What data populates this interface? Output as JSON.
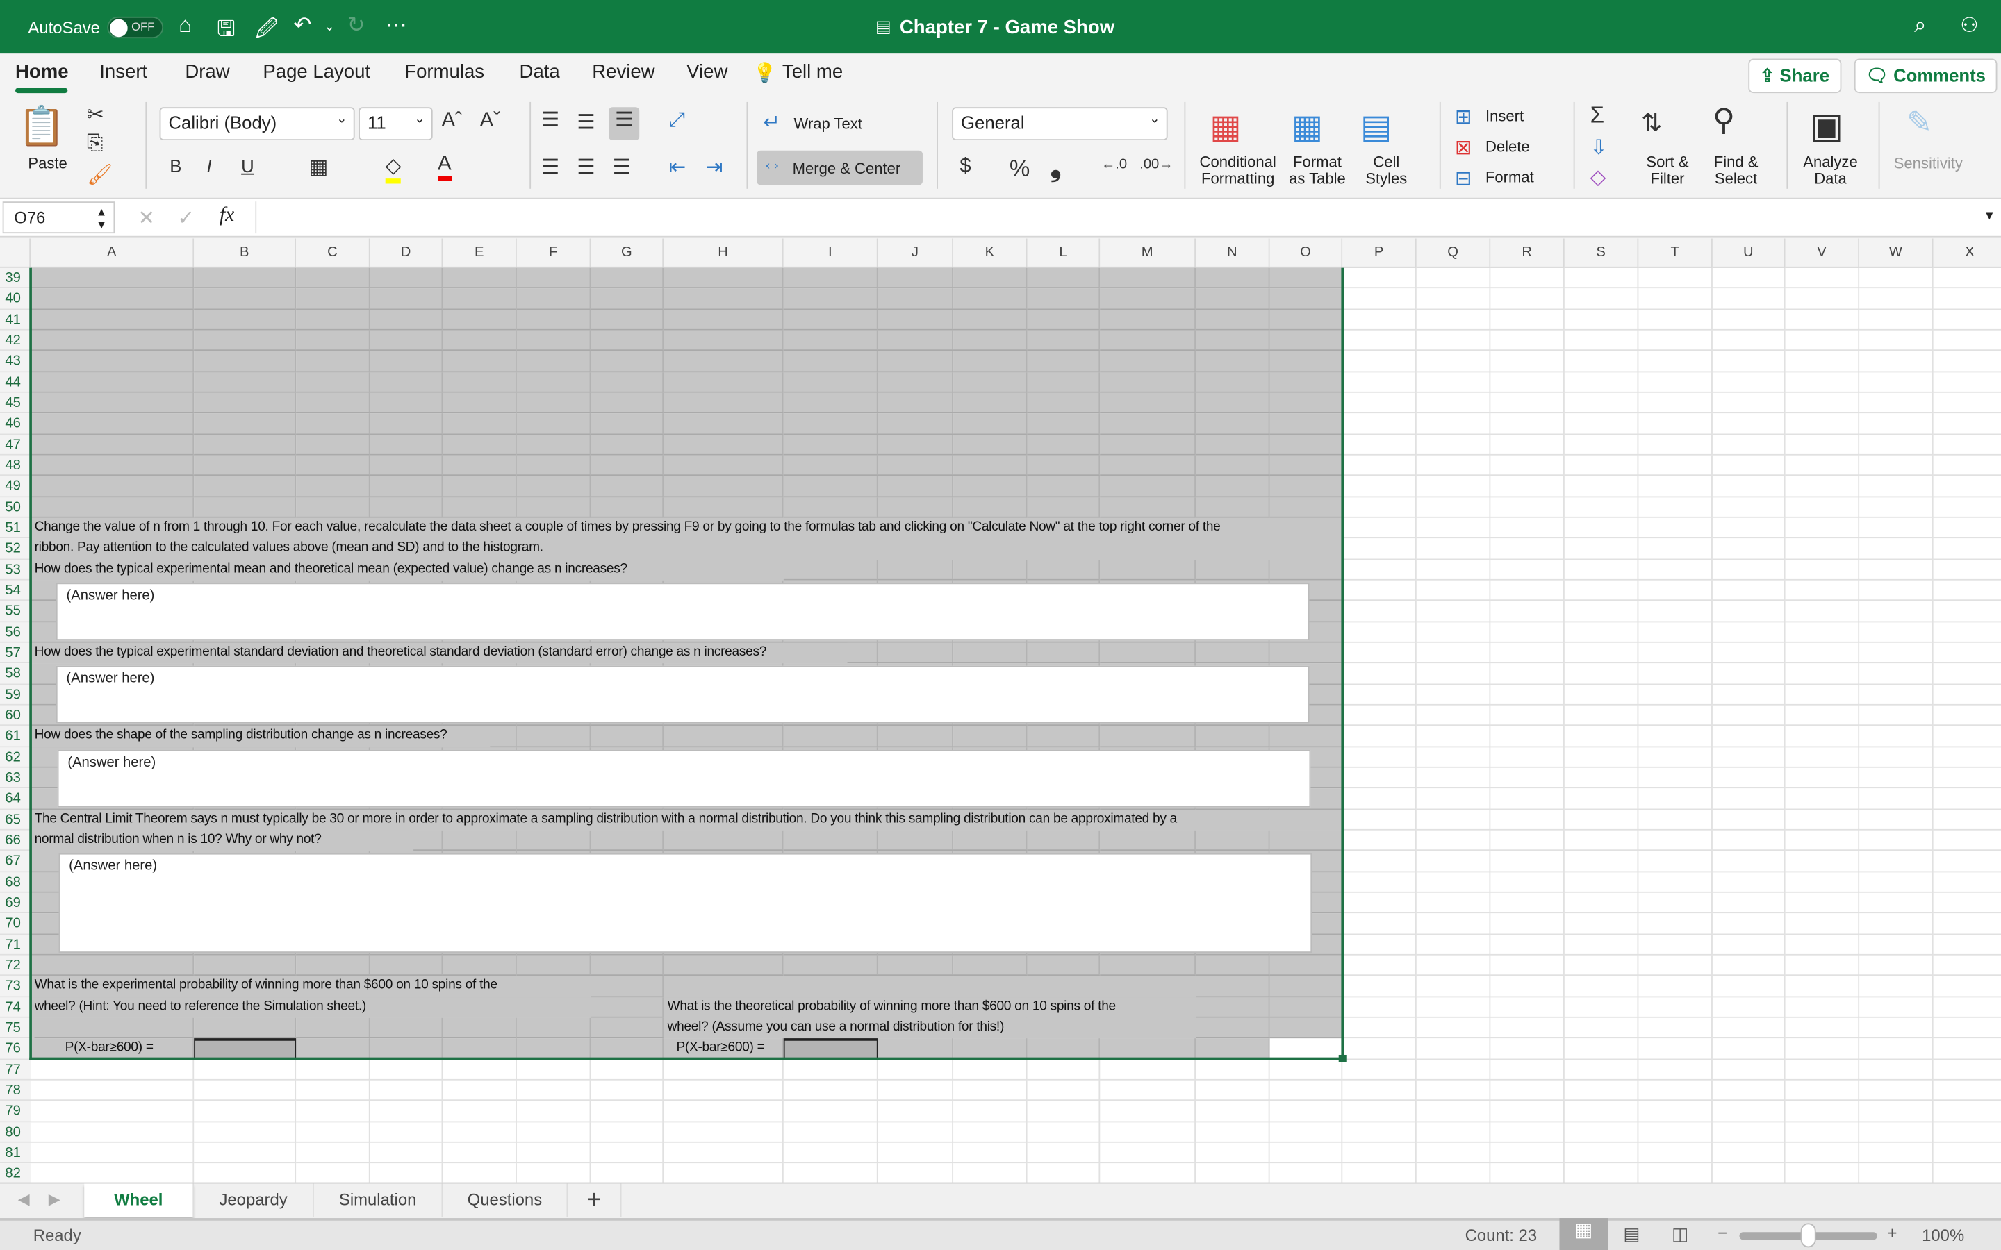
{
  "titlebar": {
    "autosave": "AutoSave",
    "autosave_state": "OFF",
    "title": "Chapter 7 - Game Show"
  },
  "tabs": [
    "Home",
    "Insert",
    "Draw",
    "Page Layout",
    "Formulas",
    "Data",
    "Review",
    "View",
    "Tell me"
  ],
  "actions": {
    "share": "Share",
    "comments": "Comments"
  },
  "ribbon": {
    "paste": "Paste",
    "font": "Calibri (Body)",
    "size": "11",
    "bold": "B",
    "italic": "I",
    "underline": "U",
    "wrap_text": "Wrap Text",
    "merge_center": "Merge & Center",
    "number_format": "General",
    "currency": "$",
    "percent": "%",
    "comma": "❟",
    "conditional_formatting": [
      "Conditional",
      "Formatting"
    ],
    "format_as_table": [
      "Format",
      "as Table"
    ],
    "cell_styles": [
      "Cell",
      "Styles"
    ],
    "insert": "Insert",
    "delete": "Delete",
    "format": "Format",
    "sort_filter": [
      "Sort &",
      "Filter"
    ],
    "find_select": [
      "Find &",
      "Select"
    ],
    "analyze_data": [
      "Analyze",
      "Data"
    ],
    "sensitivity": "Sensitivity"
  },
  "formula_bar": {
    "name_box": "O76",
    "fx": "fx",
    "value": ""
  },
  "columns": [
    "A",
    "B",
    "C",
    "D",
    "E",
    "F",
    "G",
    "H",
    "I",
    "J",
    "K",
    "L",
    "M",
    "N",
    "O",
    "P",
    "Q",
    "R",
    "S",
    "T",
    "U",
    "V",
    "W",
    "X"
  ],
  "rows": [
    "39",
    "40",
    "41",
    "42",
    "43",
    "44",
    "45",
    "46",
    "47",
    "48",
    "49",
    "50",
    "51",
    "52",
    "53",
    "54",
    "55",
    "56",
    "57",
    "58",
    "59",
    "60",
    "61",
    "62",
    "63",
    "64",
    "65",
    "66",
    "67",
    "68",
    "69",
    "70",
    "71",
    "72",
    "73",
    "74",
    "75",
    "76",
    "77",
    "78",
    "79",
    "80",
    "81",
    "82"
  ],
  "sheet": {
    "r51": "Change the value of n from 1 through 10.  For each value, recalculate the data sheet a couple of times by pressing F9 or by going to the formulas tab and clicking on \"Calculate Now\" at the top right corner of the",
    "r52": "ribbon.  Pay attention to the calculated values above (mean and SD) and to the histogram.",
    "r53": "How does the typical experimental mean and theoretical mean (expected value) change as n  increases?",
    "r57": "How does the typical experimental standard deviation and theoretical standard deviation (standard error) change as n  increases?",
    "r61": "How does the shape of the sampling distribution change as n  increases?",
    "r65": "The Central Limit Theorem says n  must typically be 30 or more in order to approximate a sampling distribution with a normal distribution.  Do you think this sampling distribution can be approximated by a",
    "r66": "normal distribution when n  is 10?  Why or why not?",
    "answers": [
      "(Answer here)",
      "(Answer here)",
      "(Answer here)",
      "(Answer here)"
    ],
    "r73": "What is the experimental probability of winning more than $600 on 10 spins of the",
    "r74": "wheel? (Hint:  You need to reference the Simulation sheet.)",
    "h74": "What is the theoretical probability of winning more than $600 on 10 spins of the",
    "h75": "wheel?  (Assume you can use a normal distribution for this!)",
    "a76": "P(X-bar≥600) =",
    "h76": "P(X-bar≥600) ="
  },
  "sheet_tabs": [
    "Wheel",
    "Jeopardy",
    "Simulation",
    "Questions"
  ],
  "add_sheet": "+",
  "status": {
    "ready": "Ready",
    "count": "Count: 23",
    "zoom": "100%",
    "zoom_level_percent": 100
  },
  "colors": {
    "accent": "#107c41",
    "selection_fill": "#c6c6c6"
  }
}
